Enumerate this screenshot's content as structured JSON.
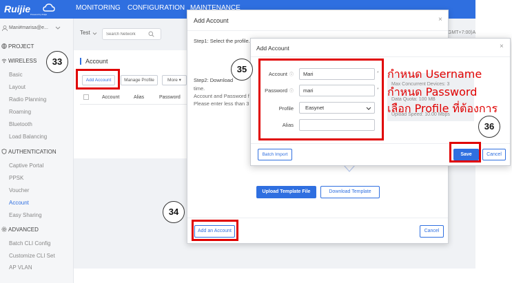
{
  "brand": {
    "name": "Ruijie",
    "tagline": "Powered by Ruijie"
  },
  "topnav": {
    "items": [
      "MONITORING",
      "CONFIGURATION",
      "MAINTENANCE"
    ]
  },
  "user": {
    "name": "Mani#marisa@e..."
  },
  "sidebar": {
    "project": "PROJECT",
    "wireless": {
      "label": "WIRELESS",
      "items": [
        "Basic",
        "Layout",
        "Radio Planning",
        "Roaming",
        "Bluetooth",
        "Load Balancing"
      ]
    },
    "authentication": {
      "label": "AUTHENTICATION",
      "items": [
        "Captive Portal",
        "PPSK",
        "Voucher",
        "Account",
        "Easy Sharing"
      ]
    },
    "advanced": {
      "label": "ADVANCED",
      "items": [
        "Batch CLI Config",
        "Customize CLI Set",
        "AP VLAN"
      ]
    }
  },
  "content": {
    "group": "Test",
    "search_placeholder": "Search Network",
    "timezone": "GMT+7:00)A",
    "panel_title": "Account",
    "buttons": {
      "add_account": "Add Account",
      "manage_profile": "Manage Profile",
      "more": "More"
    },
    "columns": [
      "Account",
      "Alias",
      "Password"
    ]
  },
  "modal1": {
    "title": "Add Account",
    "step1": "Step1: Select the profile.",
    "step2": "Step2: Download",
    "step2_lines": [
      "time.",
      "Account and Password f",
      "Please enter less than 3"
    ],
    "upload_button": "Upload Template File",
    "download_button": "Download Template",
    "add_an_account": "Add an Account",
    "cancel": "Cancel"
  },
  "modal2": {
    "title": "Add Account",
    "fields": {
      "account_label": "Account",
      "account_value": "Mari",
      "password_label": "Password",
      "password_value": "mari",
      "profile_label": "Profile",
      "profile_value": "Easynet",
      "alias_label": "Alias",
      "alias_value": ""
    },
    "profile_info": [
      "Max Concurrent Devices: 3",
      "Data Quota: 100 MB",
      "Upload Speed: 10.00 Mbps"
    ],
    "batch_import": "Batch Import",
    "save": "Save",
    "cancel": "Cancel"
  },
  "annotations": {
    "steps": [
      "33",
      "34",
      "35",
      "36"
    ],
    "notes": [
      "กำหนด Username",
      "กำหนด Password",
      "เลือก Profile ที่ต้องการ"
    ]
  },
  "colors": {
    "primary": "#2f6fe0",
    "annotation": "#e00000"
  }
}
